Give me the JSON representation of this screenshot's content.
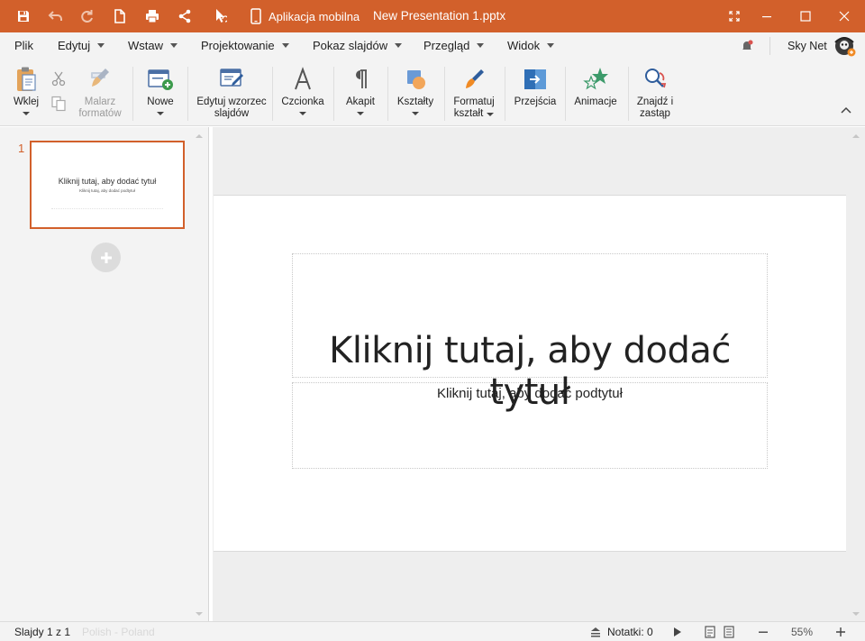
{
  "titlebar": {
    "mobile_label": "Aplikacja mobilna",
    "document_title": "New Presentation 1.pptx",
    "accent_color": "#d2602b"
  },
  "menu": {
    "items": [
      "Plik",
      "Edytuj",
      "Wstaw",
      "Projektowanie",
      "Pokaz slajdów",
      "Przegląd",
      "Widok"
    ],
    "user_name": "Sky Net"
  },
  "ribbon": {
    "paste": "Wklej",
    "format_painter_1": "Malarz",
    "format_painter_2": "formatów",
    "new": "Nowe",
    "edit_master_1": "Edytuj wzorzec",
    "edit_master_2": "slajdów",
    "font": "Czcionka",
    "paragraph": "Akapit",
    "shapes": "Kształty",
    "format_shape_1": "Formatuj",
    "format_shape_2": "kształt",
    "transitions": "Przejścia",
    "animations": "Animacje",
    "find_replace_1": "Znajdź i",
    "find_replace_2": "zastąp"
  },
  "slides_panel": {
    "slide_number": "1",
    "thumb_title": "Kliknij tutaj, aby dodać tytuł",
    "thumb_subtitle": "Kliknij tutaj, aby dodać podtytuł"
  },
  "slide": {
    "title_placeholder": "Kliknij tutaj, aby dodać tytuł",
    "subtitle_placeholder": "Kliknij tutaj, aby dodać podtytuł"
  },
  "statusbar": {
    "slide_count": "Slajdy 1 z 1",
    "language": "Polish - Poland",
    "notes": "Notatki: 0",
    "zoom": "55%"
  }
}
